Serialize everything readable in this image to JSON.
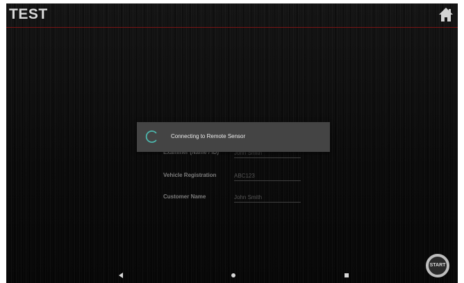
{
  "app_bar": {
    "title": "TEST",
    "home_icon": "home-icon",
    "divider_color": "#7a1414"
  },
  "form": {
    "fields": [
      {
        "label": "Examiner (Name / ID)",
        "value": "John Smith"
      },
      {
        "label": "Vehicle Registration",
        "value": "ABC123"
      },
      {
        "label": "Customer Name",
        "value": "John Smith"
      }
    ]
  },
  "dialog": {
    "message": "Connecting to Remote Sensor",
    "spinner_icon": "spinner-icon",
    "spinner_color": "#4db6ac"
  },
  "nav_bar": {
    "back_icon": "back-triangle-icon",
    "home_icon": "home-circle-icon",
    "recent_icon": "recent-square-icon"
  },
  "start_button": {
    "label": "START"
  }
}
